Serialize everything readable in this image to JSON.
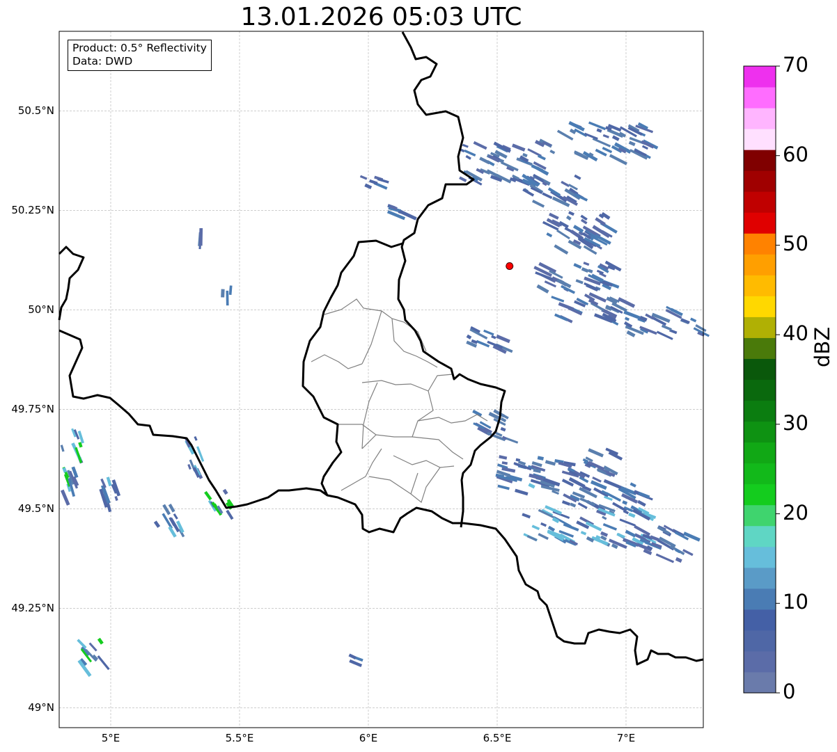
{
  "title": "13.01.2026 05:03 UTC",
  "info": {
    "product": "Product: 0.5° Reflectivity",
    "source": "Data: DWD"
  },
  "map": {
    "lon_range": [
      4.8,
      7.3
    ],
    "lat_range": [
      48.95,
      50.7
    ],
    "lat_ticks": [
      {
        "value": 50.5,
        "label": "50.5°N"
      },
      {
        "value": 50.25,
        "label": "50.25°N"
      },
      {
        "value": 50.0,
        "label": "50°N"
      },
      {
        "value": 49.75,
        "label": "49.75°N"
      },
      {
        "value": 49.5,
        "label": "49.5°N"
      },
      {
        "value": 49.25,
        "label": "49.25°N"
      },
      {
        "value": 49.0,
        "label": "49°N"
      }
    ],
    "lon_ticks": [
      {
        "value": 5.0,
        "label": "5°E"
      },
      {
        "value": 5.5,
        "label": "5.5°E"
      },
      {
        "value": 6.0,
        "label": "6°E"
      },
      {
        "value": 6.5,
        "label": "6.5°E"
      },
      {
        "value": 7.0,
        "label": "7°E"
      }
    ],
    "radar_site": {
      "lon": 6.548,
      "lat": 50.11,
      "color": "#ff0000"
    },
    "gridlines": true
  },
  "colorbar": {
    "label": "dBZ",
    "min": 0,
    "max": 70,
    "step": 2.5,
    "tick_labels": [
      "0",
      "10",
      "20",
      "30",
      "40",
      "50",
      "60",
      "70"
    ],
    "colors": [
      "#6a7bab",
      "#5b6ca8",
      "#4f67a6",
      "#4460a6",
      "#4a7cb4",
      "#5a9bc7",
      "#66bedb",
      "#5fd6c4",
      "#3fd46e",
      "#14cc1e",
      "#12b91a",
      "#11a815",
      "#0e9212",
      "#0b7d10",
      "#0a690d",
      "#0a580b",
      "#4a7a0a",
      "#b0b004",
      "#ffd800",
      "#ffbb00",
      "#ff9f00",
      "#ff8200",
      "#e00000",
      "#c00000",
      "#a00000",
      "#800000",
      "#ffe0ff",
      "#ffb5ff",
      "#ff6dff",
      "#ee30ee"
    ]
  },
  "colors": {
    "border": "#000000",
    "district": "#808080",
    "grid": "#b0b0b0",
    "echo_weak": "#4f67a6",
    "echo_moderate": "#66bedb",
    "echo_strong": "#14cc1e"
  }
}
